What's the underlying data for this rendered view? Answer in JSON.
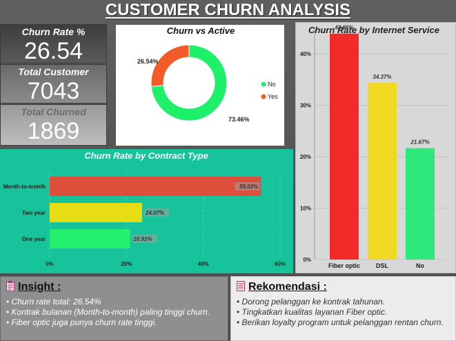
{
  "title": "CUSTOMER CHURN ANALYSIS",
  "kpis": [
    {
      "label": "Churn Rate %",
      "value": "26.54"
    },
    {
      "label": "Total Customer",
      "value": "7043"
    },
    {
      "label": "Total Churned",
      "value": "1869"
    }
  ],
  "colors": {
    "no": "#1ef06a",
    "yes": "#f25a28",
    "contract_panel": "#17c39a",
    "fiber": "#f22a2a",
    "dsl": "#f0d823",
    "no_service": "#2ee87c"
  },
  "chart_data": [
    {
      "type": "pie",
      "title": "Churn vs Active",
      "donut": true,
      "categories": [
        "No",
        "Yes"
      ],
      "values": [
        73.46,
        26.54
      ],
      "value_labels": [
        "73.46%",
        "26.54%"
      ],
      "legend": [
        "No",
        "Yes"
      ],
      "legend_position": "right"
    },
    {
      "type": "bar",
      "orientation": "horizontal",
      "title": "Churn Rate by Contract Type",
      "categories": [
        "Month-to-month",
        "Two year",
        "One year"
      ],
      "values": [
        55.02,
        24.07,
        20.91
      ],
      "value_labels": [
        "55.02%",
        "24.07%",
        "20.91%"
      ],
      "xlim": [
        0,
        60
      ],
      "xticks": [
        "0%",
        "20%",
        "40%",
        "60%"
      ],
      "grid": true
    },
    {
      "type": "bar",
      "title": "Churn Rate by Internet Service",
      "categories": [
        "Fiber optic",
        "DSL",
        "No"
      ],
      "values": [
        43.96,
        34.37,
        21.67
      ],
      "value_labels": [
        "43.96%",
        "34.37%",
        "21.67%"
      ],
      "ylim": [
        0,
        45
      ],
      "yticks": [
        "0%",
        "10%",
        "20%",
        "30%",
        "40%"
      ],
      "grid": true
    }
  ],
  "insight": {
    "heading": "Insight :",
    "icon": "clipboard-icon",
    "items": [
      "Churn rate total: 26.54%",
      "Kontrak bulanan (Month-to-month) paling tinggi churn.",
      "Fiber optic juga punya churn rate tinggi."
    ]
  },
  "rekomendasi": {
    "heading": "Rekomendasi :",
    "icon": "document-icon",
    "items": [
      "Dorong pelanggan ke kontrak tahunan.",
      "Tingkatkan kualitas layanan Fiber optic.",
      "Berikan loyalty program untuk pelanggan rentan churn."
    ]
  }
}
